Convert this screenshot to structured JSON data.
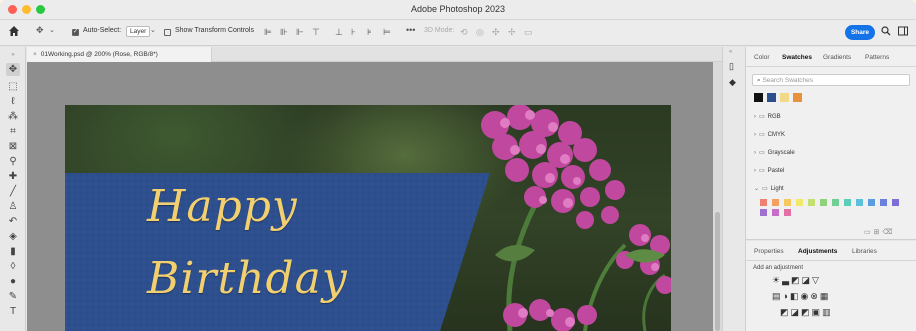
{
  "app": {
    "title": "Adobe Photoshop 2023"
  },
  "options_bar": {
    "auto_select_label": "Auto-Select:",
    "auto_select_value": "Layer",
    "show_transform_label": "Show Transform Controls",
    "mode_3d_label": "3D Mode:",
    "share_label": "Share"
  },
  "document": {
    "tab_label": "01Working.psd @ 200% (Rose, RGB/8*)"
  },
  "canvas": {
    "greeting_line1": "Happy",
    "greeting_line2": "Birthday",
    "banner_color": "#2d4f8e",
    "text_color": "#f2cf6f"
  },
  "swatches_panel": {
    "tabs": [
      "Color",
      "Swatches",
      "Gradients",
      "Patterns"
    ],
    "active_tab": "Swatches",
    "search_placeholder": "Search Swatches",
    "recent_colors": [
      "#111111",
      "#2d4f8e",
      "#f2d98a",
      "#e8913c"
    ],
    "groups": [
      "RGB",
      "CMYK",
      "Grayscale",
      "Pastel",
      "Light"
    ],
    "expanded_group": "Light",
    "light_row1": [
      "#f08070",
      "#f4a060",
      "#f7c860",
      "#f2e86a",
      "#c4e070",
      "#8fd27a",
      "#6fcf94",
      "#5ccdb8",
      "#5cc0dc",
      "#5a9ce0",
      "#6a80da",
      "#7c6ed6"
    ],
    "light_row2": [
      "#a070d0",
      "#c86ec8",
      "#e070a6"
    ]
  },
  "adjustments_panel": {
    "tabs": [
      "Properties",
      "Adjustments",
      "Libraries"
    ],
    "active_tab": "Adjustments",
    "add_label": "Add an adjustment"
  },
  "icons": {
    "home": "home-icon",
    "move": "move-icon",
    "search": "search-icon",
    "layout": "panel-layout-icon"
  }
}
